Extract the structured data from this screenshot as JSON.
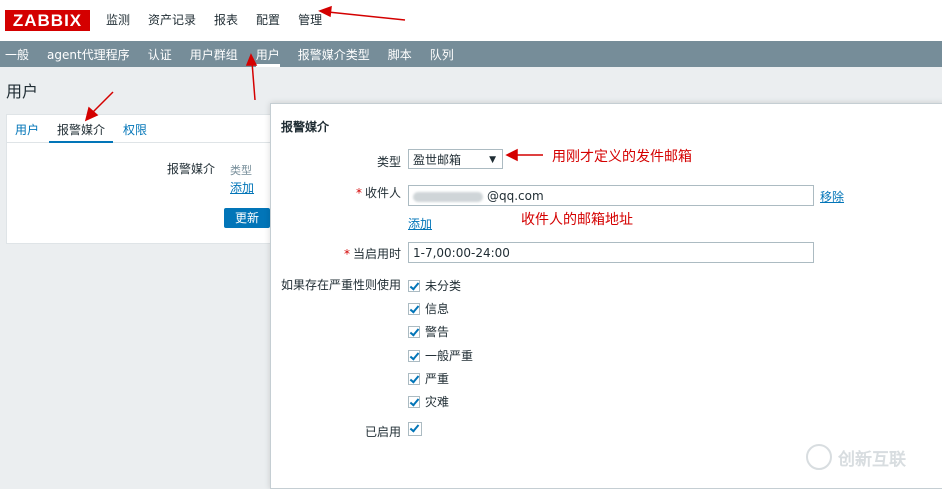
{
  "header": {
    "logo": "ZABBIX",
    "nav": [
      "监测",
      "资产记录",
      "报表",
      "配置",
      "管理"
    ],
    "active_nav": "管理"
  },
  "subnav": {
    "items": [
      "一般",
      "agent代理程序",
      "认证",
      "用户群组",
      "用户",
      "报警媒介类型",
      "脚本",
      "队列"
    ],
    "active": "用户"
  },
  "page": {
    "title": "用户"
  },
  "user_form": {
    "tabs": [
      "用户",
      "报警媒介",
      "权限"
    ],
    "active_tab": "报警媒介",
    "media_label": "报警媒介",
    "type_column": "类型",
    "add_link": "添加",
    "update_button": "更新"
  },
  "dialog": {
    "title": "报警媒介",
    "type_label": "类型",
    "type_value": "盈世邮箱",
    "recipient_label": "收件人",
    "recipient_value": "@qq.com",
    "remove_link": "移除",
    "add_link": "添加",
    "when_active_label": "当启用时",
    "when_active_value": "1-7,00:00-24:00",
    "severity_label": "如果存在严重性则使用",
    "severities": [
      "未分类",
      "信息",
      "警告",
      "一般严重",
      "严重",
      "灾难"
    ],
    "enabled_label": "已启用"
  },
  "annotations": {
    "type_note": "用刚才定义的发件邮箱",
    "recipient_note": "收件人的邮箱地址"
  },
  "watermark": "创新互联",
  "colors": {
    "brand": "#d40000",
    "subnav": "#768d99",
    "link": "#0275b8",
    "annotation": "#d40000"
  }
}
